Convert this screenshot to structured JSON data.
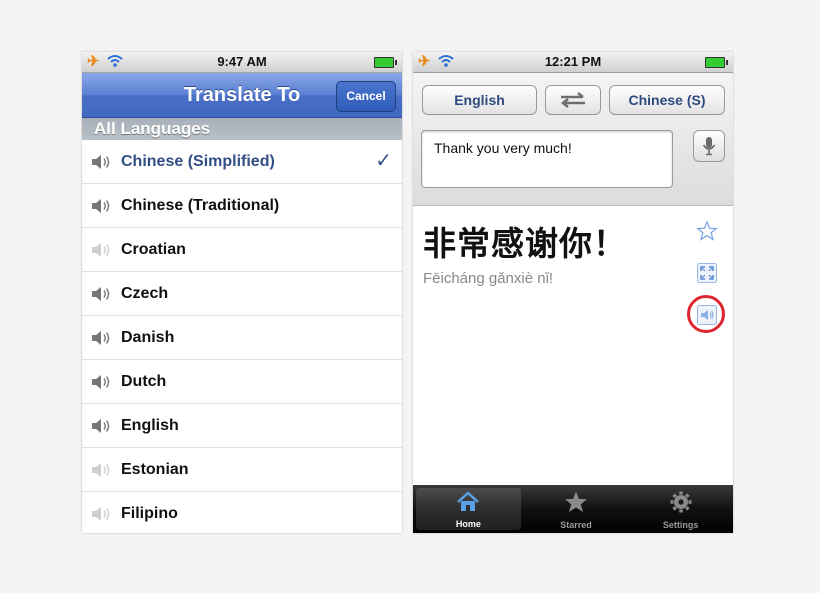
{
  "left": {
    "status": {
      "time": "9:47 AM"
    },
    "nav": {
      "title": "Translate To",
      "cancel_label": "Cancel"
    },
    "section_header": "All Languages",
    "languages": [
      {
        "name": "Chinese (Simplified)",
        "selected": true,
        "speech": true
      },
      {
        "name": "Chinese (Traditional)",
        "selected": false,
        "speech": true
      },
      {
        "name": "Croatian",
        "selected": false,
        "speech": false
      },
      {
        "name": "Czech",
        "selected": false,
        "speech": true
      },
      {
        "name": "Danish",
        "selected": false,
        "speech": true
      },
      {
        "name": "Dutch",
        "selected": false,
        "speech": true
      },
      {
        "name": "English",
        "selected": false,
        "speech": true
      },
      {
        "name": "Estonian",
        "selected": false,
        "speech": false
      },
      {
        "name": "Filipino",
        "selected": false,
        "speech": false
      }
    ],
    "check_glyph": "✓"
  },
  "right": {
    "status": {
      "time": "12:21 PM"
    },
    "source_lang": "English",
    "target_lang": "Chinese (S)",
    "input_text": "Thank you very much!",
    "translation": "非常感谢你！",
    "pinyin": "Fēicháng gǎnxiè nǐ!",
    "tabs": [
      {
        "label": "Home",
        "icon": "home-icon",
        "active": true
      },
      {
        "label": "Starred",
        "icon": "star-icon",
        "active": false
      },
      {
        "label": "Settings",
        "icon": "gear-icon",
        "active": false
      }
    ]
  },
  "colors": {
    "nav_blue": "#4a6fc6",
    "selected_text": "#324f85",
    "highlight_ring": "#e0232e",
    "button_text": "#2d4a7e"
  }
}
